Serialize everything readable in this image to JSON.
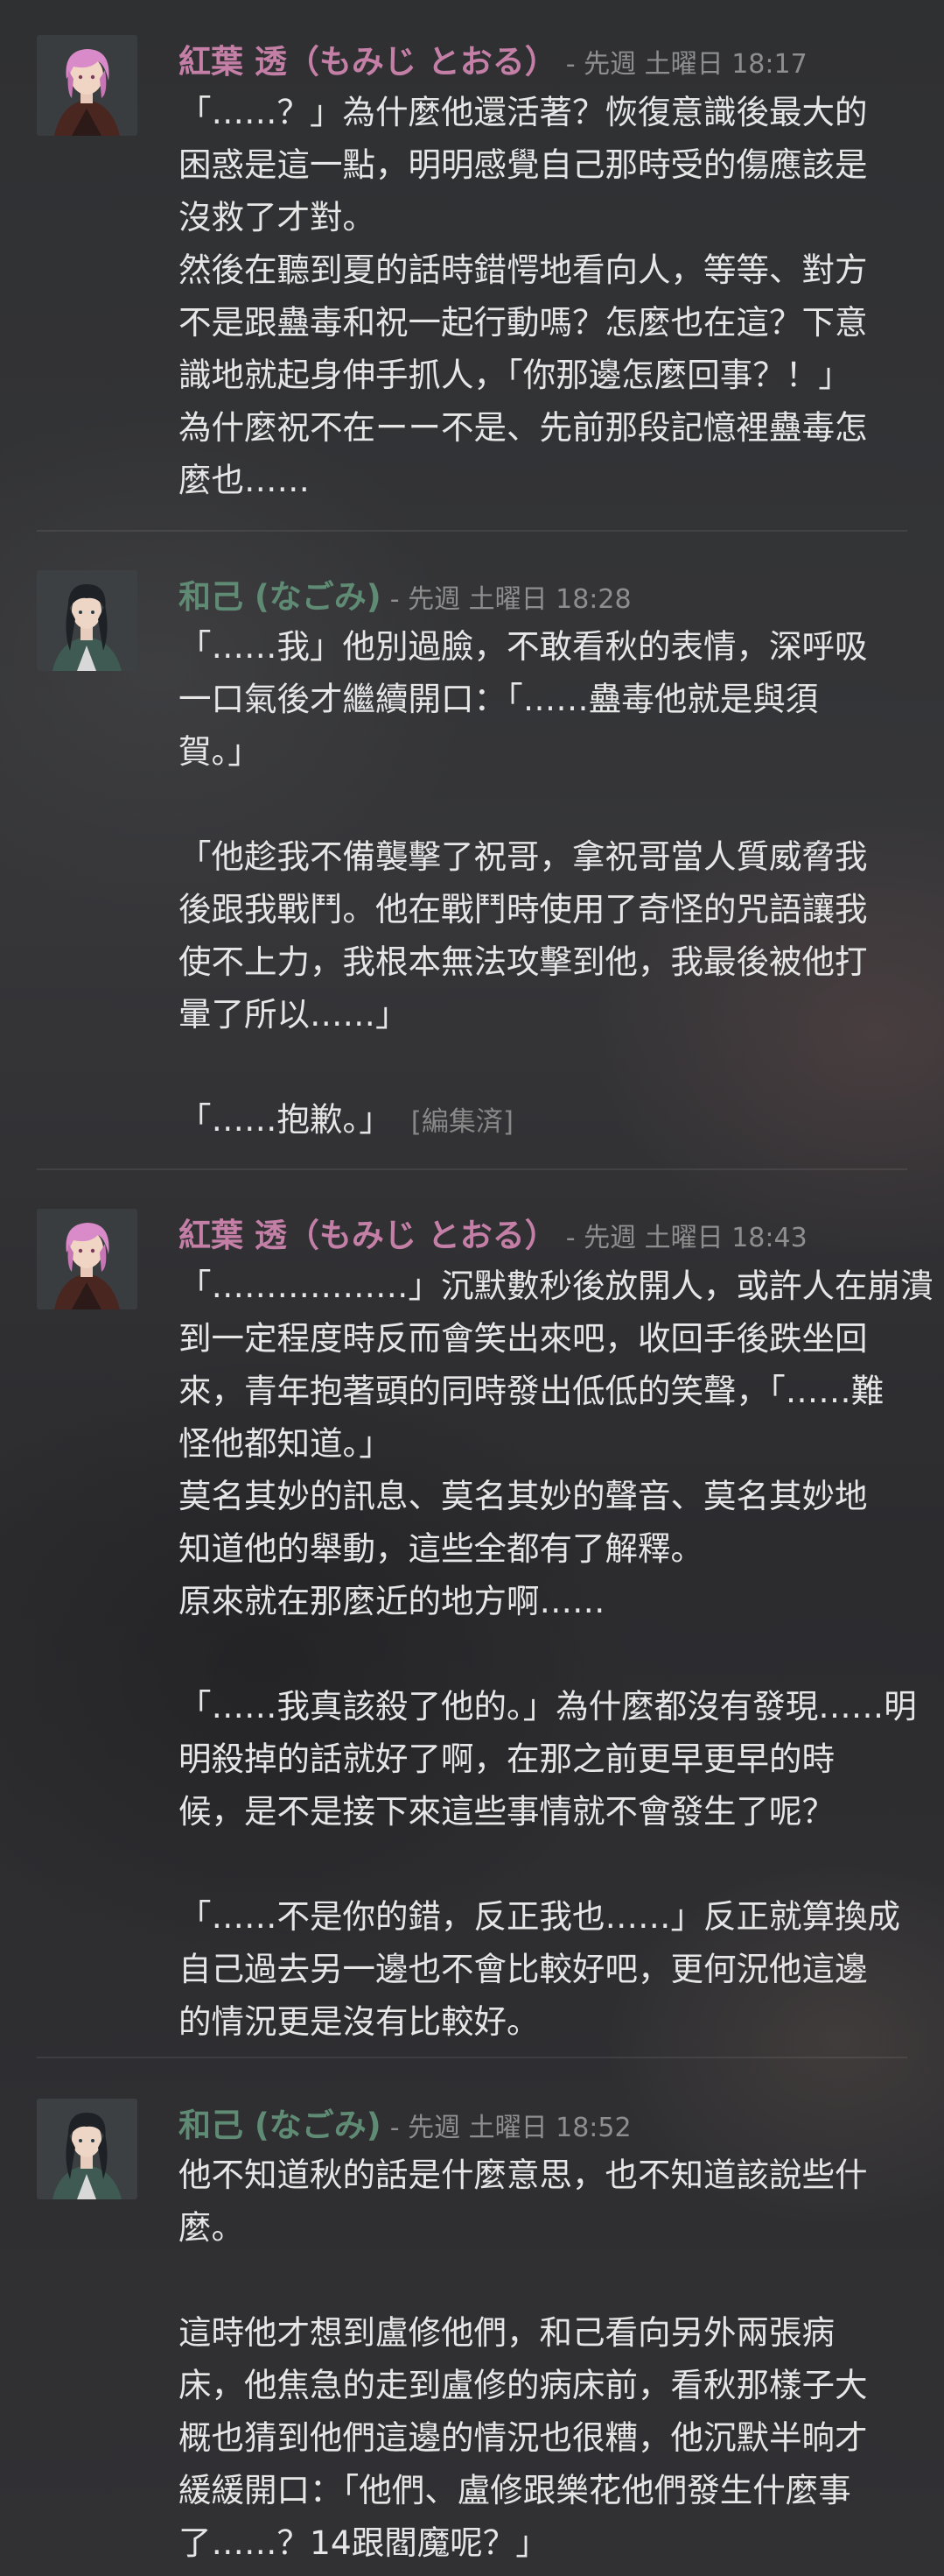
{
  "colors": {
    "momiji": "#c47fa7",
    "nagomi": "#5f8a73",
    "timestamp": "#8e8e8e",
    "text": "#e6e6e6"
  },
  "messages": [
    {
      "author": "紅葉 透（もみじ とおる）",
      "timestamp": "- 先週 土曜日 18:17",
      "avatar": "pink-haired-character-avatar",
      "lines": [
        "「……？」為什麼他還活著？恢復意識後最大的",
        "困惑是這一點，明明感覺自己那時受的傷應該是",
        "沒救了才對。",
        "然後在聽到夏的話時錯愕地看向人，等等、對方",
        "不是跟蠱毒和祝一起行動嗎？怎麼也在這？下意",
        "識地就起身伸手抓人，「你那邊怎麼回事？！」",
        "為什麼祝不在ーー不是、先前那段記憶裡蠱毒怎",
        "麼也……"
      ]
    },
    {
      "author": "和己 (なごみ)",
      "timestamp": "- 先週 土曜日 18:28",
      "avatar": "dark-haired-character-avatar",
      "lines": [
        "「……我」他別過臉，不敢看秋的表情，深呼吸",
        "一口氣後才繼續開口：「……蠱毒他就是與須",
        "賀。」",
        "",
        "「他趁我不備襲擊了祝哥，拿祝哥當人質威脅我",
        "後跟我戰鬥。他在戰鬥時使用了奇怪的咒語讓我",
        "使不上力，我根本無法攻擊到他，我最後被他打",
        "暈了所以……」",
        "",
        "「……抱歉。」"
      ],
      "edited_label": "[編集済]"
    },
    {
      "author": "紅葉 透（もみじ とおる）",
      "timestamp": "- 先週 土曜日 18:43",
      "avatar": "pink-haired-character-avatar",
      "lines": [
        "「………………」沉默數秒後放開人，或許人在崩潰",
        "到一定程度時反而會笑出來吧，收回手後跌坐回",
        "來，青年抱著頭的同時發出低低的笑聲，「……難",
        "怪他都知道。」",
        "莫名其妙的訊息、莫名其妙的聲音、莫名其妙地",
        "知道他的舉動，這些全都有了解釋。",
        "原來就在那麼近的地方啊……",
        "",
        "「……我真該殺了他的。」為什麼都沒有發現……明",
        "明殺掉的話就好了啊，在那之前更早更早的時",
        "候，是不是接下來這些事情就不會發生了呢？",
        "",
        "「……不是你的錯，反正我也……」反正就算換成",
        "自己過去另一邊也不會比較好吧，更何況他這邊",
        "的情況更是沒有比較好。"
      ]
    },
    {
      "author": "和己 (なごみ)",
      "timestamp": "- 先週 土曜日 18:52",
      "avatar": "dark-haired-character-avatar",
      "lines": [
        "他不知道秋的話是什麼意思，也不知道該說些什",
        "麼。",
        "",
        "這時他才想到盧修他們，和己看向另外兩張病",
        "床，他焦急的走到盧修的病床前，看秋那樣子大",
        "概也猜到他們這邊的情況也很糟，他沉默半晌才",
        "緩緩開口：「他們、盧修跟樂花他們發生什麼事",
        "了……？14跟閻魔呢？」"
      ]
    }
  ]
}
